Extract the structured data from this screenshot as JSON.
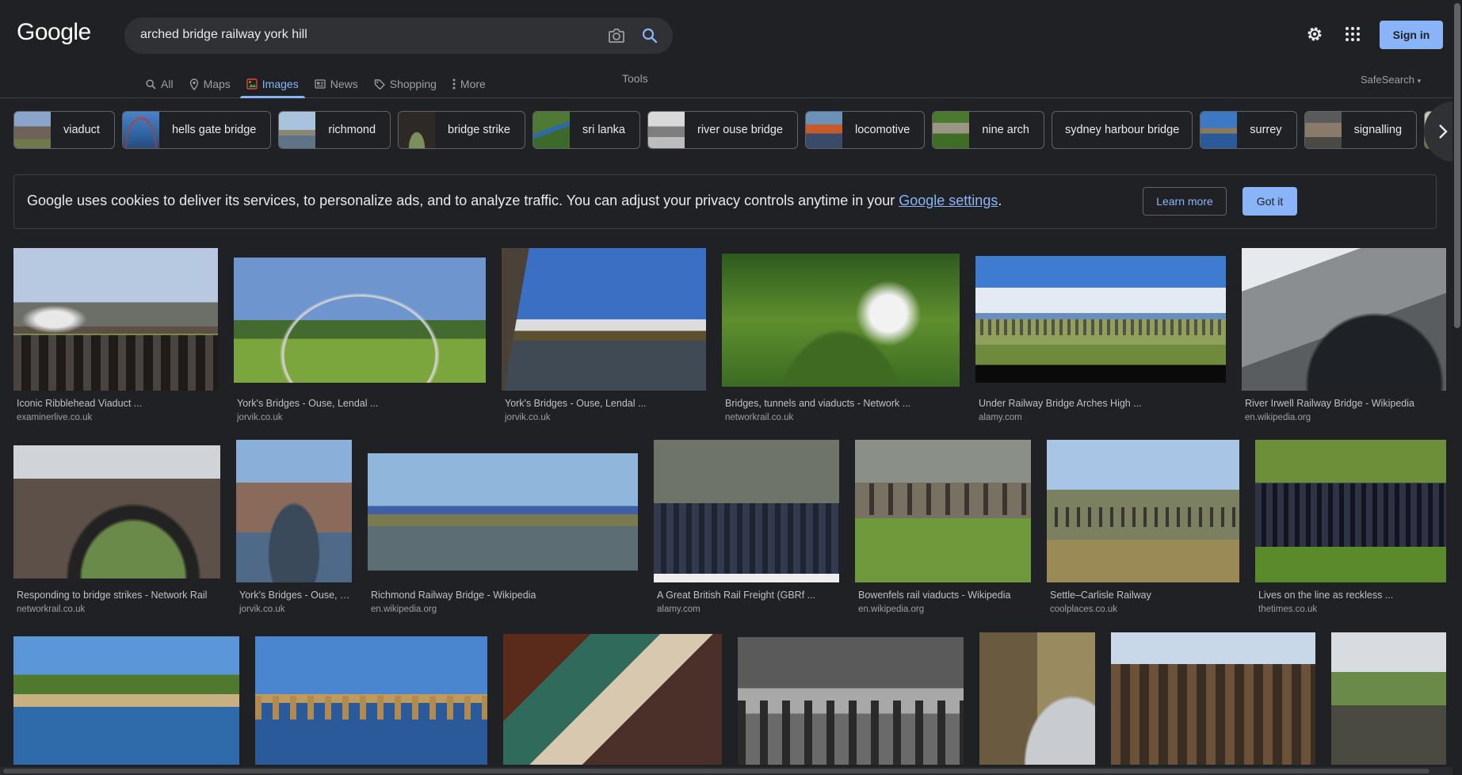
{
  "brand": {
    "logo": "Google"
  },
  "search": {
    "query": "arched bridge railway york hill"
  },
  "header": {
    "sign_in": "Sign in",
    "tools": "Tools",
    "safesearch": "SafeSearch"
  },
  "tabs": [
    {
      "label": "All",
      "icon": "search-icon"
    },
    {
      "label": "Maps",
      "icon": "map-pin-icon"
    },
    {
      "label": "Images",
      "icon": "image-icon",
      "active": true
    },
    {
      "label": "News",
      "icon": "news-icon"
    },
    {
      "label": "Shopping",
      "icon": "tag-icon"
    },
    {
      "label": "More",
      "icon": "more-vert-icon"
    }
  ],
  "chips": [
    {
      "label": "viaduct"
    },
    {
      "label": "hells gate bridge"
    },
    {
      "label": "richmond"
    },
    {
      "label": "bridge strike"
    },
    {
      "label": "sri lanka"
    },
    {
      "label": "river ouse bridge"
    },
    {
      "label": "locomotive"
    },
    {
      "label": "nine arch"
    },
    {
      "label": "sydney harbour bridge"
    },
    {
      "label": "surrey"
    },
    {
      "label": "signalling"
    }
  ],
  "cookie": {
    "text": "Google uses cookies to deliver its services, to personalize ads, and to analyze traffic. You can adjust your privacy controls anytime in your ",
    "link": "Google settings",
    "end": ".",
    "learn_more": "Learn more",
    "got_it": "Got it"
  },
  "results": {
    "row1": [
      {
        "title": "Iconic Ribblehead Viaduct ...",
        "source": "examinerlive.co.uk"
      },
      {
        "title": "York's Bridges - Ouse, Lendal ...",
        "source": "jorvik.co.uk"
      },
      {
        "title": "York's Bridges - Ouse, Lendal ...",
        "source": "jorvik.co.uk"
      },
      {
        "title": "Bridges, tunnels and viaducts - Network ...",
        "source": "networkrail.co.uk"
      },
      {
        "title": "Under Railway Bridge Arches High ...",
        "source": "alamy.com"
      },
      {
        "title": "River Irwell Railway Bridge - Wikipedia",
        "source": "en.wikipedia.org"
      }
    ],
    "row2": [
      {
        "title": "Responding to bridge strikes - Network Rail",
        "source": "networkrail.co.uk"
      },
      {
        "title": "York's Bridges - Ouse, L...",
        "source": "jorvik.co.uk"
      },
      {
        "title": "Richmond Railway Bridge - Wikipedia",
        "source": "en.wikipedia.org"
      },
      {
        "title": "A Great British Rail Freight (GBRf ...",
        "source": "alamy.com"
      },
      {
        "title": "Bowenfels rail viaducts - Wikipedia",
        "source": "en.wikipedia.org"
      },
      {
        "title": "Settle–Carlisle Railway",
        "source": "coolplaces.co.uk"
      },
      {
        "title": "Lives on the line as reckless ...",
        "source": "thetimes.co.uk"
      }
    ]
  },
  "colors": {
    "background": "#202124",
    "accent": "#8ab4f8",
    "text": "#e8eaed"
  }
}
